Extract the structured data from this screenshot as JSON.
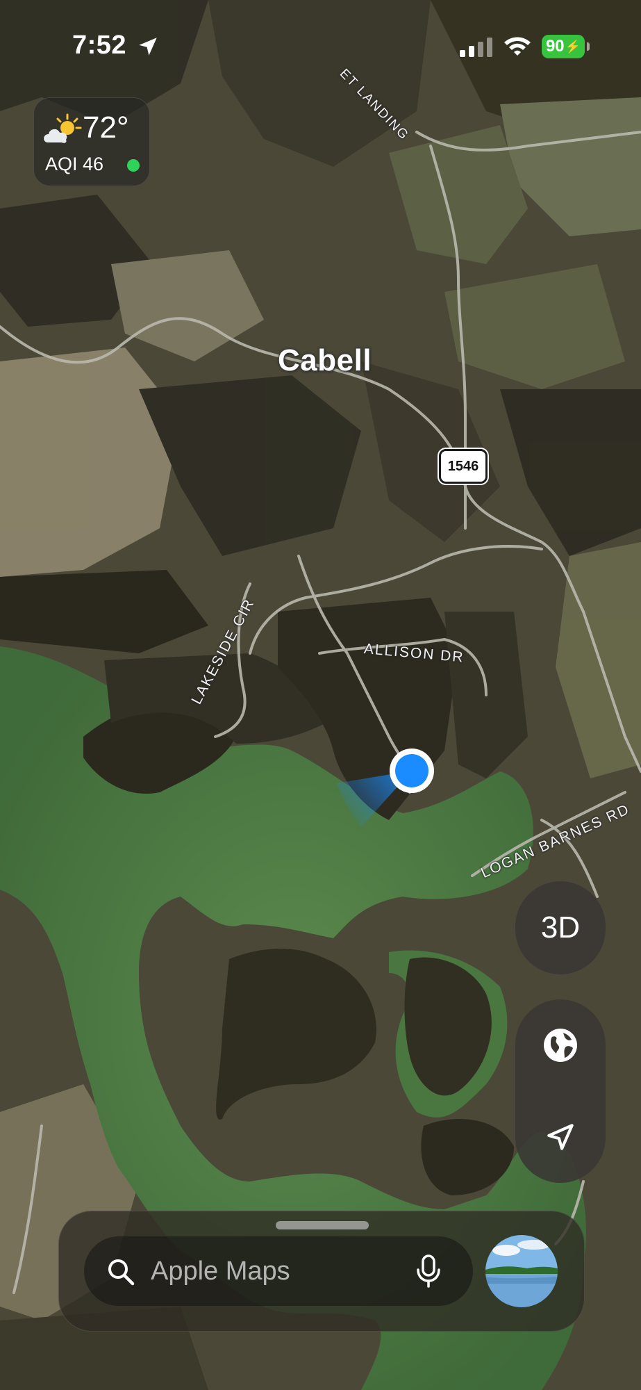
{
  "status_bar": {
    "time": "7:52",
    "battery": "90"
  },
  "weather": {
    "temperature": "72°",
    "aqi": "AQI 46",
    "aqi_color": "#2fd35a"
  },
  "map": {
    "place_name": "Cabell",
    "road_labels": {
      "allison": "ALLISON DR",
      "lakeside": "LAKESIDE CIR",
      "logan": "LOGAN BARNES RD",
      "landing": "ET LANDING"
    },
    "route_number": "1546",
    "water_color": "#4e7a44",
    "land_color": "#4a4636"
  },
  "controls": {
    "view_mode": "3D",
    "globe_icon": "globe-icon",
    "locate_icon": "location-arrow-icon"
  },
  "search": {
    "placeholder": "Apple Maps",
    "search_icon": "search-icon",
    "mic_icon": "microphone-icon"
  },
  "accent_color": "#1a8cff"
}
